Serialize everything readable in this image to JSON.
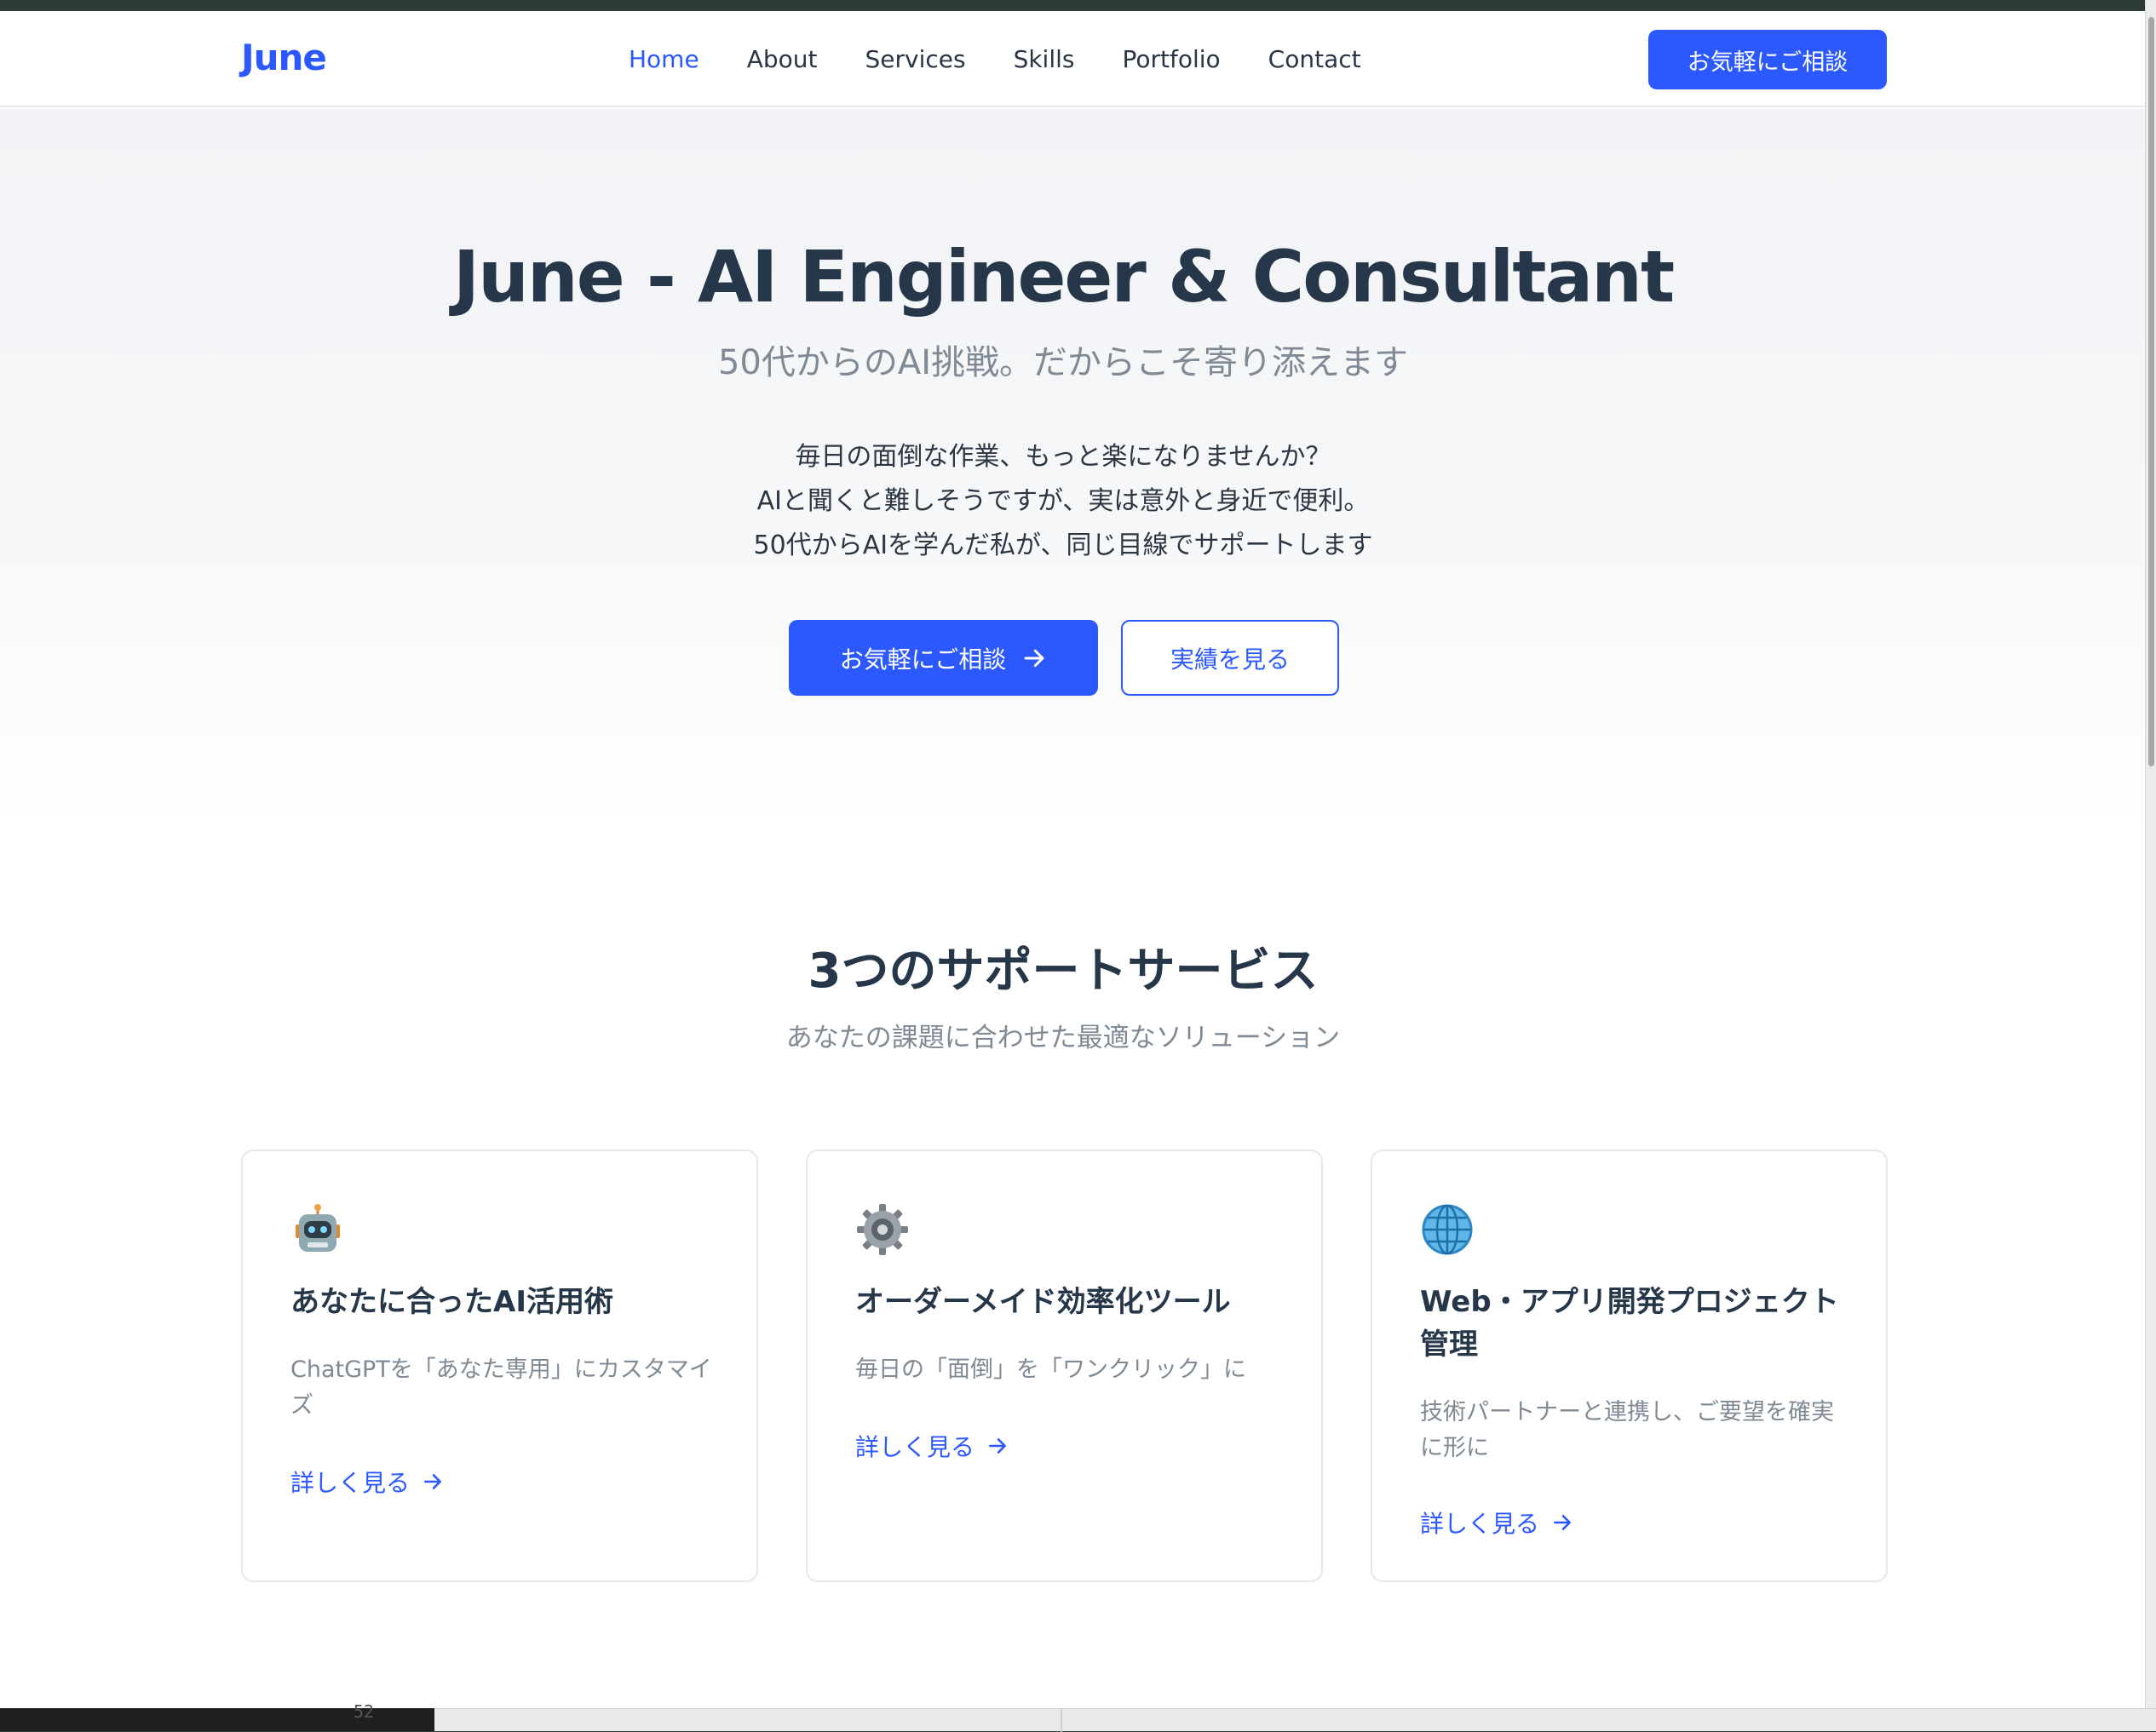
{
  "header": {
    "logo": "June",
    "nav": [
      "Home",
      "About",
      "Services",
      "Skills",
      "Portfolio",
      "Contact"
    ],
    "active_nav": "Home",
    "cta": "お気軽にご相談"
  },
  "hero": {
    "title": "June - AI Engineer & Consultant",
    "subtitle": "50代からのAI挑戦。だからこそ寄り添えます",
    "body": [
      "毎日の面倒な作業、もっと楽になりませんか？",
      "AIと聞くと難しそうですが、実は意外と身近で便利。",
      "50代からAIを学んだ私が、同じ目線でサポートします"
    ],
    "primary_button": "お気軽にご相談",
    "secondary_button": "実績を見る"
  },
  "services": {
    "title": "3つのサポートサービス",
    "subtitle": "あなたの課題に合わせた最適なソリューション",
    "cards": [
      {
        "icon": "robot-icon",
        "title": "あなたに合ったAI活用術",
        "desc": "ChatGPTを「あなた専用」にカスタマイズ",
        "link": "詳しく見る"
      },
      {
        "icon": "gear-icon",
        "title": "オーダーメイド効率化ツール",
        "desc": "毎日の「面倒」を「ワンクリック」に",
        "link": "詳しく見る"
      },
      {
        "icon": "globe-icon",
        "title": "Web・アプリ開発プロジェクト管理",
        "desc": "技術パートナーと連携し、ご要望を確実に形に",
        "link": "詳しく見る"
      }
    ]
  },
  "editor": {
    "line_number": "52"
  },
  "colors": {
    "accent": "#2b59ff",
    "heading": "#27374a",
    "muted": "#7f8a95"
  }
}
